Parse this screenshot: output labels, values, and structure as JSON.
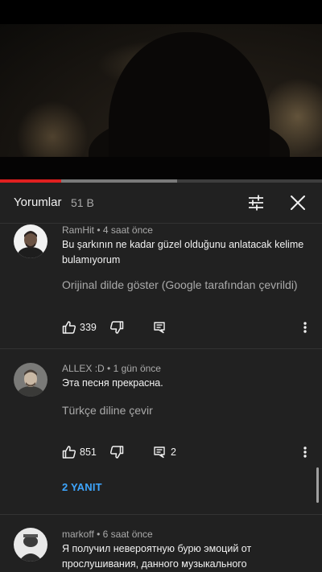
{
  "comments_panel": {
    "title": "Yorumlar",
    "count": "51 B"
  },
  "video_progress": {
    "played_fraction": 0.19,
    "buffered_fraction": 0.55
  },
  "comments": [
    {
      "author": "RamHit",
      "time": "4 saat önce",
      "text": "Bu şarkının ne kadar güzel olduğunu anlatacak kelime bulamıyorum",
      "translate_label": "Orijinal dilde göster (Google tarafından çevrildi)",
      "likes": "339",
      "replies_count": ""
    },
    {
      "author": "ALLEX :D",
      "time": "1 gün önce",
      "text": "Эта песня прекрасна.",
      "translate_label": "Türkçe diline çevir",
      "likes": "851",
      "replies_count": "2",
      "replies_link": "2 YANIT"
    },
    {
      "author": "markoff",
      "time": "6 saat önce",
      "text": "Я получил невероятную бурю эмоций от прослушивания, данного музыкального"
    }
  ],
  "meta_separator": " • ",
  "icons": {
    "filter": "sliders-icon",
    "close": "close-icon",
    "like": "thumbs-up-icon",
    "dislike": "thumbs-down-icon",
    "reply": "reply-icon",
    "more": "more-vert-icon"
  },
  "colors": {
    "panel_bg": "#212121",
    "link": "#3ea6ff",
    "progress_played": "#e02020"
  }
}
